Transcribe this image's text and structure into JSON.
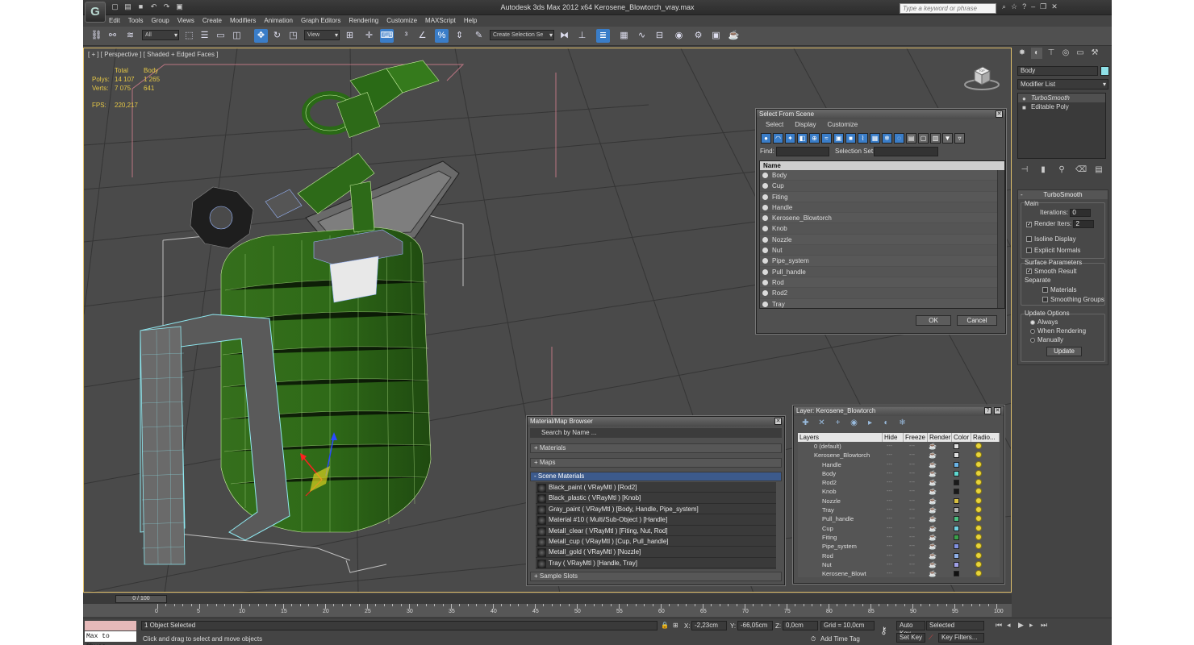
{
  "window": {
    "app_title": "Autodesk 3ds Max  2012 x64      Kerosene_Blowtorch_vray.max",
    "search_placeholder": "Type a keyword or phrase",
    "logo_glyph": "G"
  },
  "menu": [
    "Edit",
    "Tools",
    "Group",
    "Views",
    "Create",
    "Modifiers",
    "Animation",
    "Graph Editors",
    "Rendering",
    "Customize",
    "MAXScript",
    "Help"
  ],
  "toolbar": {
    "filter_value": "All",
    "ref_coord_value": "View",
    "named_selection_placeholder": "Create Selection Se",
    "accent": "#3a7dc8"
  },
  "viewport": {
    "label": "[ + ] [ Perspective ] [ Shaded + Edged Faces ]",
    "stats": {
      "hdr_total": "Total",
      "hdr_body": "Body",
      "polys_label": "Polys:",
      "polys_total": "14 107",
      "polys_body": "1 265",
      "verts_label": "Verts:",
      "verts_total": "7 075",
      "verts_body": "641",
      "fps_label": "FPS:",
      "fps_value": "220,217"
    },
    "viewcube_label": "TOP"
  },
  "command_panel": {
    "object_name": "Body",
    "object_color": "#8fe1e8",
    "modifier_list": "Modifier List",
    "stack": [
      {
        "label": "TurboSmooth",
        "selected": true
      },
      {
        "label": "Editable Poly",
        "selected": false
      }
    ],
    "rollout_title": "TurboSmooth",
    "main_label": "Main",
    "iterations_label": "Iterations:",
    "iterations_value": "0",
    "render_iters_label": "Render Iters:",
    "render_iters_value": "2",
    "isoline_label": "Isoline Display",
    "explicit_label": "Explicit Normals",
    "surface_params_label": "Surface Parameters",
    "smooth_result_label": "Smooth Result",
    "separate_label": "Separate",
    "materials_label": "Materials",
    "smoothing_groups_label": "Smoothing Groups",
    "update_options_label": "Update Options",
    "always_label": "Always",
    "when_rendering_label": "When Rendering",
    "manually_label": "Manually",
    "update_button": "Update"
  },
  "select_from_scene": {
    "title": "Select From Scene",
    "menu": [
      "Select",
      "Display",
      "Customize"
    ],
    "find_label": "Find:",
    "selection_set_label": "Selection Set:",
    "column_name": "Name",
    "rows": [
      "Body",
      "Cup",
      "Fiting",
      "Handle",
      "Kerosene_Blowtorch",
      "Knob",
      "Nozzle",
      "Nut",
      "Pipe_system",
      "Pull_handle",
      "Rod",
      "Rod2",
      "Tray"
    ],
    "ok": "OK",
    "cancel": "Cancel"
  },
  "material_browser": {
    "title": "Material/Map Browser",
    "search": "Search by Name ...",
    "cat_materials": "+ Materials",
    "cat_maps": "+ Maps",
    "cat_scene": "- Scene Materials",
    "cat_sample": "+ Sample Slots",
    "items": [
      "Black_paint  ( VRayMtl )  [Rod2]",
      "Black_plastic  ( VRayMtl )  [Knob]",
      "Gray_paint  ( VRayMtl )  [Body, Handle, Pipe_system]",
      "Material #10  ( Multi/Sub-Object )  [Handle]",
      "Metall_clear  ( VRayMtl )  [Fiting, Nut, Rod]",
      "Metall_cup  ( VRayMtl )  [Cup, Pull_handle]",
      "Metall_gold  ( VRayMtl )  [Nozzle]",
      "Tray  ( VRayMtl )  [Handle, Tray]"
    ]
  },
  "layer_dialog": {
    "title": "Layer: Kerosene_Blowtorch",
    "columns": [
      "Layers",
      "Hide",
      "Freeze",
      "Render",
      "Color",
      "Radio..."
    ],
    "rows": [
      {
        "name": "0 (default)",
        "color": "#e0e0e0",
        "indent": 1
      },
      {
        "name": "Kerosene_Blowtorch",
        "color": "#e0e0e0",
        "indent": 1
      },
      {
        "name": "Handle",
        "color": "#6ab4e8",
        "indent": 2
      },
      {
        "name": "Body",
        "color": "#5ed8d0",
        "indent": 2
      },
      {
        "name": "Rod2",
        "color": "#1a1a1a",
        "indent": 2
      },
      {
        "name": "Knob",
        "color": "#1a1a1a",
        "indent": 2
      },
      {
        "name": "Nozzle",
        "color": "#d8c040",
        "indent": 2
      },
      {
        "name": "Tray",
        "color": "#b0b0b0",
        "indent": 2
      },
      {
        "name": "Pull_handle",
        "color": "#4ac080",
        "indent": 2
      },
      {
        "name": "Cup",
        "color": "#70d0e0",
        "indent": 2
      },
      {
        "name": "Fiting",
        "color": "#3aa04a",
        "indent": 2
      },
      {
        "name": "Pipe_system",
        "color": "#8090e0",
        "indent": 2
      },
      {
        "name": "Rod",
        "color": "#8fb0e8",
        "indent": 2
      },
      {
        "name": "Nut",
        "color": "#a0a0e8",
        "indent": 2
      },
      {
        "name": "Kerosene_Blowt",
        "color": "#111111",
        "indent": 2
      }
    ]
  },
  "timeline": {
    "slider": "0 / 100",
    "ticks": [
      "0",
      "5",
      "10",
      "15",
      "20",
      "25",
      "30",
      "35",
      "40",
      "45",
      "50",
      "55",
      "60",
      "65",
      "70",
      "75",
      "80",
      "85",
      "90",
      "95",
      "100"
    ]
  },
  "status": {
    "maxscript": "Max to Physc.",
    "objects_selected": "1 Object Selected",
    "prompt": "Click and drag to select and move objects",
    "x_label": "X:",
    "x_value": "-2,23cm",
    "y_label": "Y:",
    "y_value": "-66,05cm",
    "z_label": "Z:",
    "z_value": "0,0cm",
    "grid": "Grid = 10,0cm",
    "add_time_tag": "Add Time Tag",
    "auto_key": "Auto Key",
    "set_key": "Set Key",
    "key_mode": "Selected",
    "key_filters": "Key Filters..."
  }
}
